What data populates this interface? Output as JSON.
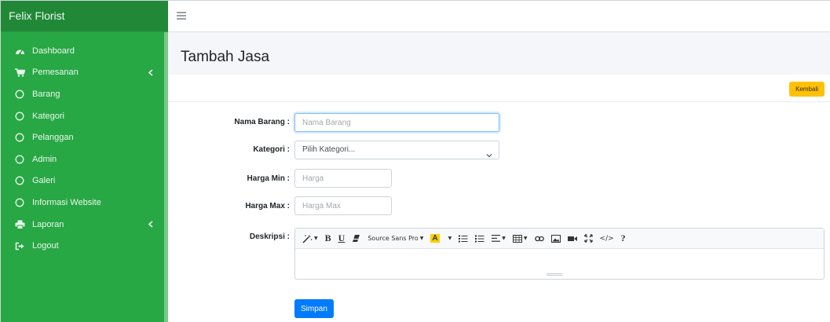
{
  "app": {
    "brand": "Felix Florist"
  },
  "sidebar": {
    "items": [
      {
        "label": "Dashboard",
        "icon": "dashboard-icon",
        "has_chevron": false
      },
      {
        "label": "Pemesanan",
        "icon": "cart-icon",
        "has_chevron": true
      },
      {
        "label": "Barang",
        "icon": "circle-icon",
        "has_chevron": false
      },
      {
        "label": "Kategori",
        "icon": "circle-icon",
        "has_chevron": false
      },
      {
        "label": "Pelanggan",
        "icon": "circle-icon",
        "has_chevron": false
      },
      {
        "label": "Admin",
        "icon": "circle-icon",
        "has_chevron": false
      },
      {
        "label": "Galeri",
        "icon": "circle-icon",
        "has_chevron": false
      },
      {
        "label": "Informasi Website",
        "icon": "circle-icon",
        "has_chevron": false
      },
      {
        "label": "Laporan",
        "icon": "print-icon",
        "has_chevron": true
      },
      {
        "label": "Logout",
        "icon": "logout-icon",
        "has_chevron": false
      }
    ]
  },
  "topbar": {
    "menu_icon": "hamburger-icon"
  },
  "header": {
    "title": "Tambah Jasa"
  },
  "card": {
    "back_label": "Kembali"
  },
  "form": {
    "nama_barang": {
      "label": "Nama Barang :",
      "placeholder": "Nama Barang",
      "value": ""
    },
    "kategori": {
      "label": "Kategori :",
      "selected": "Pilih Kategori..."
    },
    "harga_min": {
      "label": "Harga Min :",
      "placeholder": "Harga",
      "value": ""
    },
    "harga_max": {
      "label": "Harga Max :",
      "placeholder": "Harga Max",
      "value": ""
    },
    "deskripsi": {
      "label": "Deskripsi :",
      "value": ""
    },
    "submit_label": "Simpan"
  },
  "editor": {
    "font_name": "Source Sans Pro",
    "bold": "B",
    "underline": "U",
    "font_color": "A",
    "help": "?",
    "code_view": "</>"
  },
  "colors": {
    "sidebar_bg": "#28a745",
    "brand_bg": "#218838",
    "back_button": "#ffc107",
    "save_button": "#007bff",
    "header_bg": "#f4f6f9"
  }
}
